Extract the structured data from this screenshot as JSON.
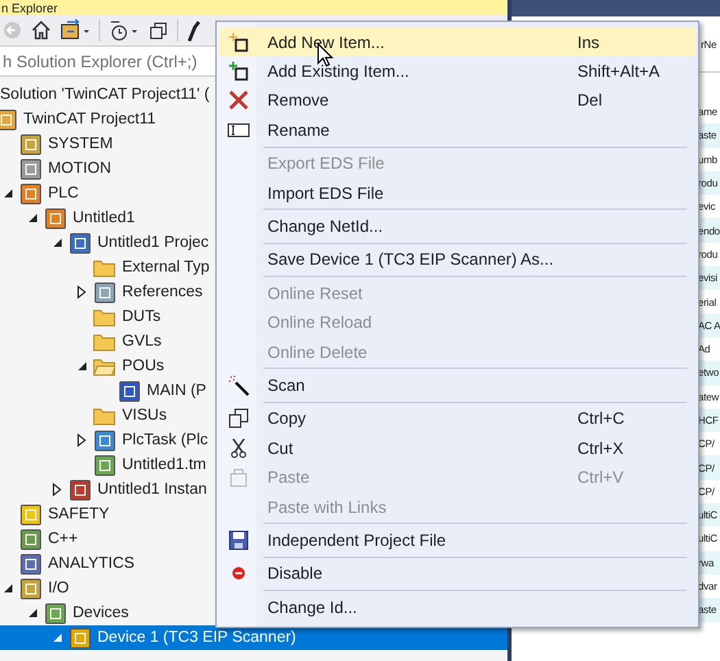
{
  "window": {
    "title": "n Explorer"
  },
  "search": {
    "placeholder": "h Solution Explorer (Ctrl+;)"
  },
  "tree": [
    {
      "label": "Solution 'TwinCAT Project11' (",
      "selected": false,
      "children": [
        {
          "label": "TwinCAT Project11",
          "kind": "project",
          "selected": false,
          "children": [
            {
              "label": "SYSTEM",
              "kind": "system",
              "selected": false
            },
            {
              "label": "MOTION",
              "kind": "motion",
              "selected": false
            },
            {
              "label": "PLC",
              "kind": "plc",
              "expanded": true,
              "selected": false,
              "children": [
                {
                  "label": "Untitled1",
                  "kind": "plc",
                  "expanded": true,
                  "selected": false,
                  "children": [
                    {
                      "label": "Untitled1 Projec",
                      "kind": "plcproject",
                      "expanded": true,
                      "selected": false,
                      "children": [
                        {
                          "label": "External Typ",
                          "kind": "folder",
                          "selected": false
                        },
                        {
                          "label": "References",
                          "kind": "references",
                          "expanded": false,
                          "selected": false
                        },
                        {
                          "label": "DUTs",
                          "kind": "folder",
                          "selected": false
                        },
                        {
                          "label": "GVLs",
                          "kind": "folder",
                          "selected": false
                        },
                        {
                          "label": "POUs",
                          "kind": "folder-open",
                          "expanded": true,
                          "selected": false,
                          "children": [
                            {
                              "label": "MAIN (P",
                              "kind": "pou",
                              "selected": false
                            }
                          ]
                        },
                        {
                          "label": "VISUs",
                          "kind": "folder",
                          "selected": false
                        },
                        {
                          "label": "PlcTask (Plc",
                          "kind": "task",
                          "expanded": false,
                          "selected": false
                        },
                        {
                          "label": "Untitled1.tm",
                          "kind": "tmc",
                          "selected": false
                        }
                      ]
                    },
                    {
                      "label": "Untitled1 Instan",
                      "kind": "instance",
                      "expanded": false,
                      "selected": false
                    }
                  ]
                }
              ]
            },
            {
              "label": "SAFETY",
              "kind": "safety",
              "selected": false
            },
            {
              "label": "C++",
              "kind": "cpp",
              "selected": false
            },
            {
              "label": "ANALYTICS",
              "kind": "analytics",
              "selected": false
            },
            {
              "label": "I/O",
              "kind": "io",
              "expanded": true,
              "selected": false,
              "children": [
                {
                  "label": "Devices",
                  "kind": "devices",
                  "expanded": true,
                  "selected": false,
                  "children": [
                    {
                      "label": "Device 1 (TC3 EIP Scanner)",
                      "kind": "device",
                      "expanded": true,
                      "selected": true
                    }
                  ]
                }
              ]
            }
          ]
        }
      ]
    }
  ],
  "menu": {
    "items": [
      {
        "kind": "add-new",
        "label": "Add New Item...",
        "shortcut": "Ins",
        "disabled": false,
        "selected": true
      },
      {
        "kind": "add-existing",
        "label": "Add Existing Item...",
        "shortcut": "Shift+Alt+A",
        "disabled": false,
        "selected": false
      },
      {
        "kind": "remove",
        "label": "Remove",
        "shortcut": "Del",
        "disabled": false,
        "selected": false
      },
      {
        "kind": "rename",
        "label": "Rename",
        "disabled": false,
        "selected": false
      },
      {
        "kind": "separator"
      },
      {
        "kind": "plain",
        "label": "Export EDS File",
        "disabled": true,
        "selected": false
      },
      {
        "kind": "plain",
        "label": "Import EDS File",
        "disabled": false,
        "selected": false
      },
      {
        "kind": "separator"
      },
      {
        "kind": "plain",
        "label": "Change NetId...",
        "disabled": false,
        "selected": false
      },
      {
        "kind": "separator"
      },
      {
        "kind": "plain",
        "label": "Save Device 1 (TC3 EIP Scanner) As...",
        "disabled": false,
        "selected": false
      },
      {
        "kind": "separator"
      },
      {
        "kind": "plain",
        "label": "Online Reset",
        "disabled": true,
        "selected": false
      },
      {
        "kind": "plain",
        "label": "Online Reload",
        "disabled": true,
        "selected": false
      },
      {
        "kind": "plain",
        "label": "Online Delete",
        "disabled": true,
        "selected": false
      },
      {
        "kind": "separator"
      },
      {
        "kind": "scan",
        "label": "Scan",
        "disabled": false,
        "selected": false
      },
      {
        "kind": "separator"
      },
      {
        "kind": "copy",
        "label": "Copy",
        "shortcut": "Ctrl+C",
        "disabled": false,
        "selected": false
      },
      {
        "kind": "cut",
        "label": "Cut",
        "shortcut": "Ctrl+X",
        "disabled": false,
        "selected": false
      },
      {
        "kind": "paste",
        "label": "Paste",
        "shortcut": "Ctrl+V",
        "disabled": true,
        "selected": false
      },
      {
        "kind": "plain",
        "label": "Paste with Links",
        "disabled": true,
        "selected": false
      },
      {
        "kind": "separator"
      },
      {
        "kind": "save",
        "label": "Independent Project File",
        "disabled": false,
        "selected": false
      },
      {
        "kind": "separator"
      },
      {
        "kind": "disable",
        "label": "Disable",
        "disabled": false,
        "selected": false
      },
      {
        "kind": "separator"
      },
      {
        "kind": "plain",
        "label": "Change Id...",
        "disabled": false,
        "selected": false
      }
    ]
  },
  "property_panel": {
    "column_1": "rNe",
    "rows": [
      "ame",
      "aste",
      "umb",
      "rodu",
      "evic",
      "endo",
      "rodu",
      "evisi",
      "erial",
      "AC A",
      "Ad",
      "etwo",
      "atew",
      "HCF",
      "CP/",
      "CP/",
      "CP/",
      "ultiC",
      "ultiC",
      "rwa",
      "dvar",
      "aste"
    ]
  }
}
